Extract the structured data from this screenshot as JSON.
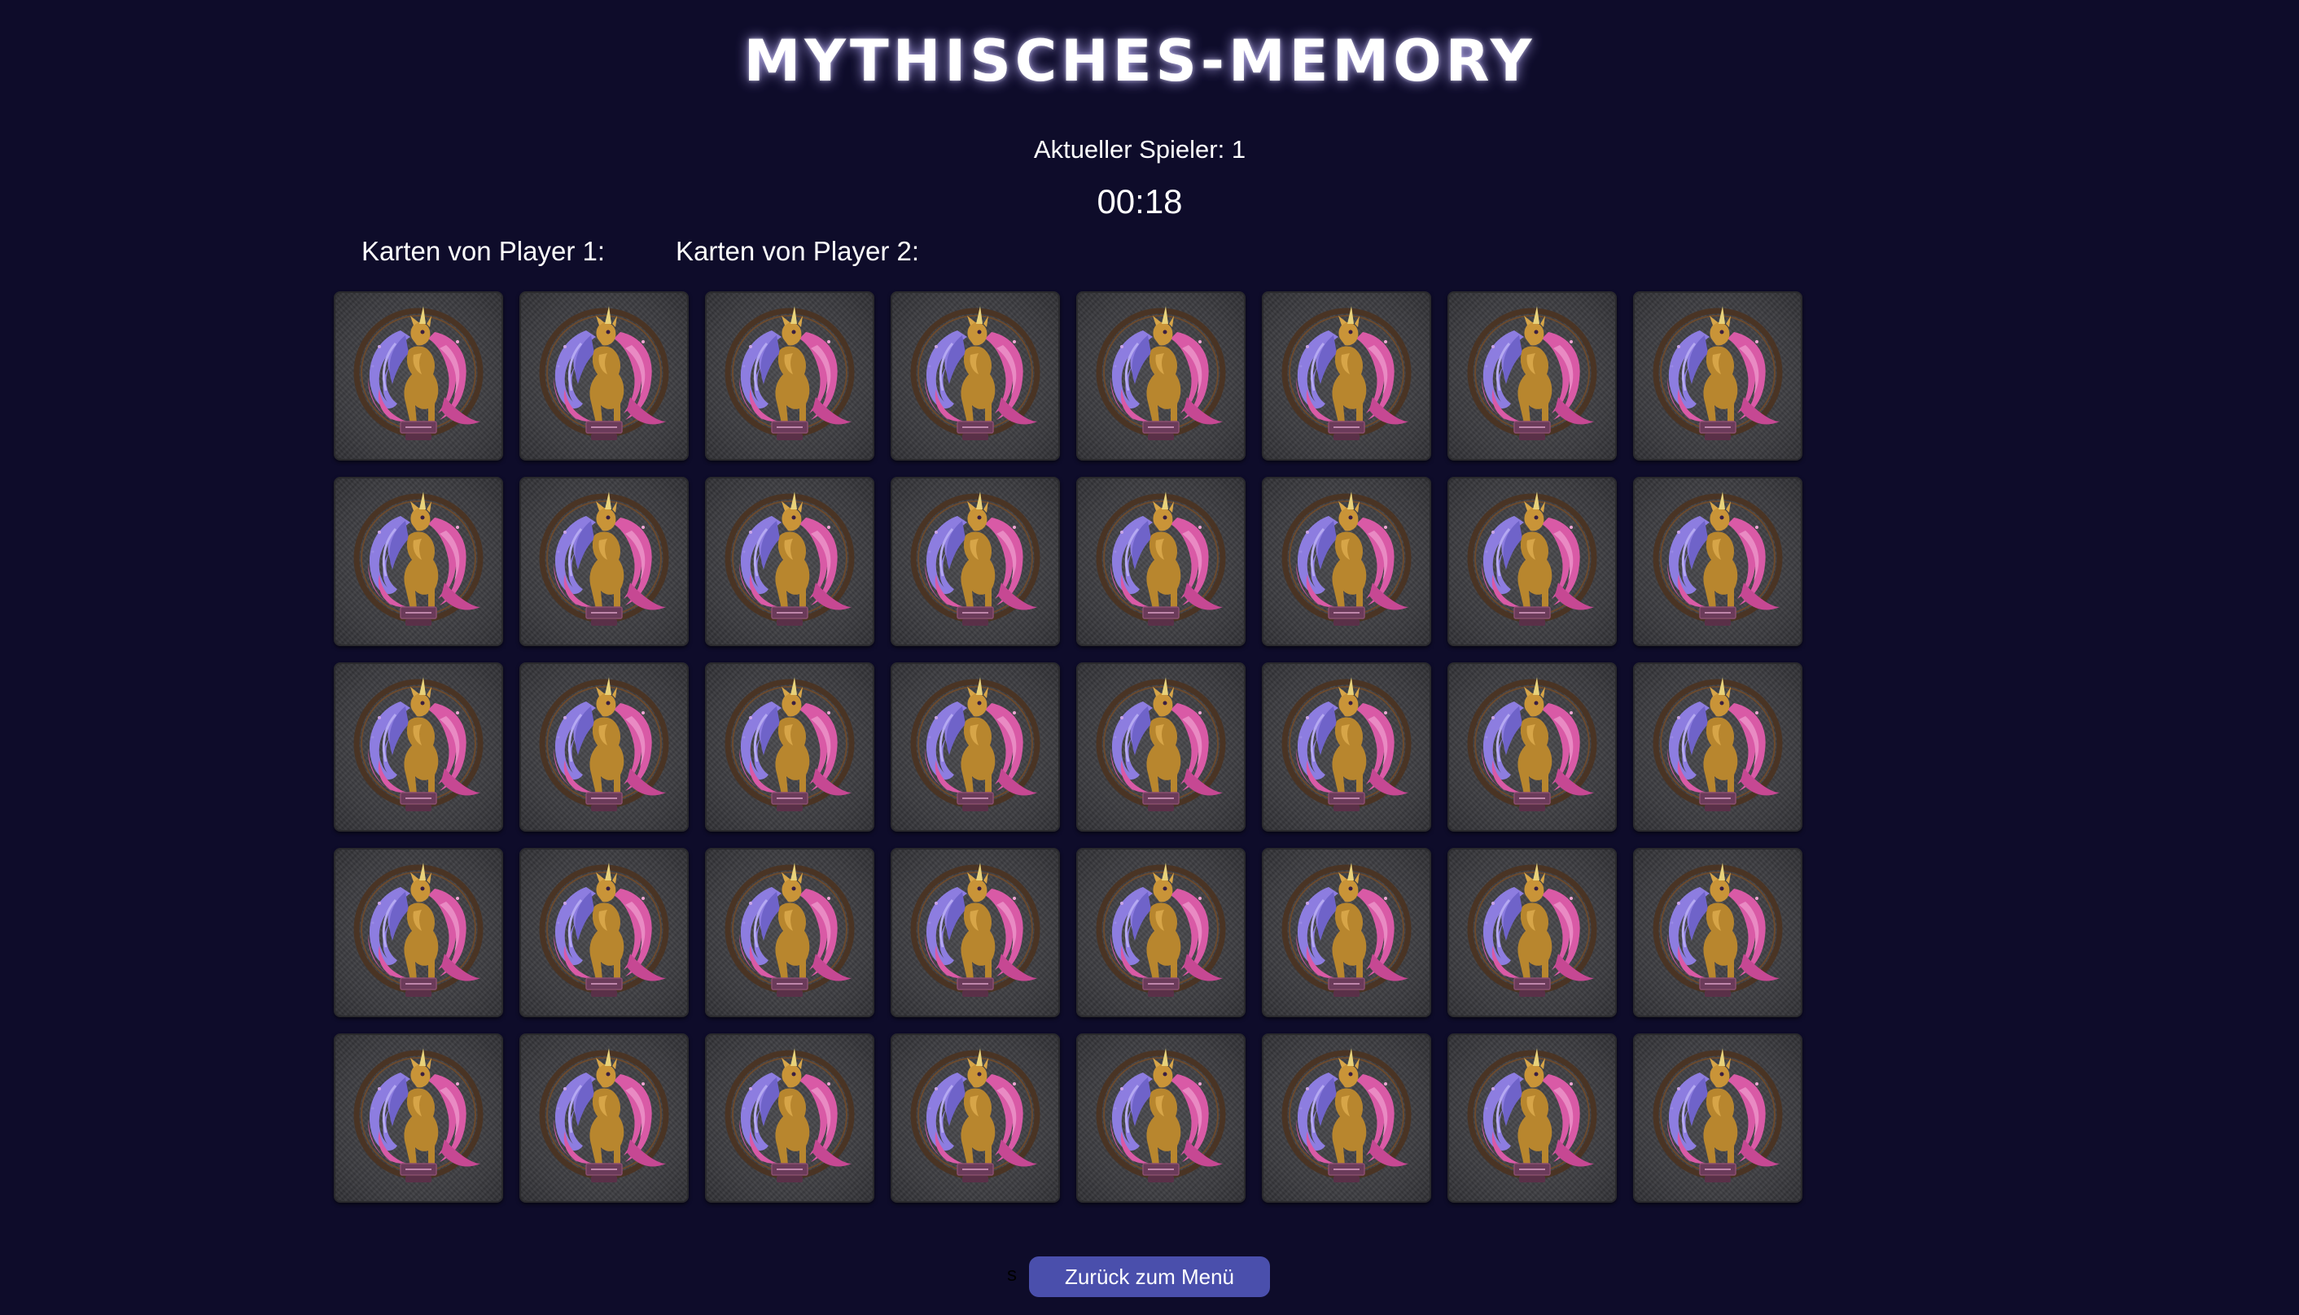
{
  "header": {
    "title": "MYTHISCHES-MEMORY",
    "current_player": "Aktueller Spieler: 1",
    "timer": "00:18"
  },
  "players": [
    {
      "cards_label": "Karten von Player 1:"
    },
    {
      "cards_label": "Karten von Player 2:"
    }
  ],
  "board": {
    "rows": 5,
    "columns": 8,
    "card_back_icon": "unicorn-crest-card-back-icon",
    "colors": {
      "card_background": "#3f3f43",
      "mane_purple": "#8d7de0",
      "ribbon_pink": "#d95aa6",
      "body_gold": "#b8862e"
    }
  },
  "footer": {
    "stray_text": "s",
    "back_button_label": "Zurück zum Menü"
  },
  "colors": {
    "page_background": "#0e0c2a",
    "button_background": "#4a4fac"
  }
}
